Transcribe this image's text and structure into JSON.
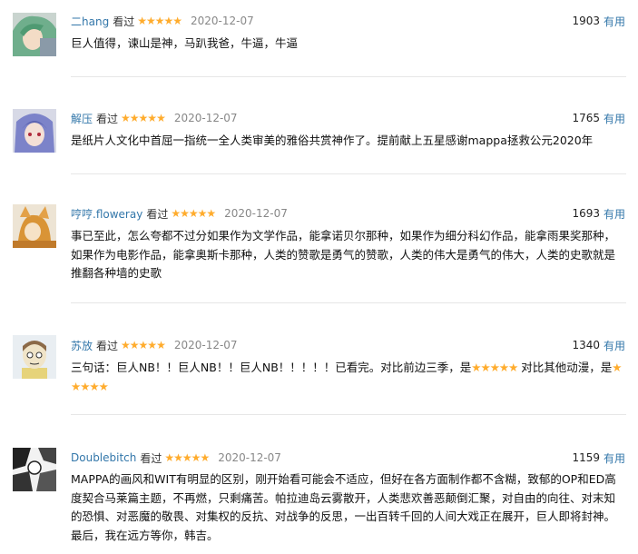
{
  "watched_label": "看过",
  "useful_label": "有用",
  "star_glyph": "★★★★★",
  "colors": {
    "link": "#3377aa",
    "star": "#ffac2d",
    "date": "#888888"
  },
  "reviews": [
    {
      "user": "二hang",
      "rating": 5,
      "date": "2020-12-07",
      "votes": "1903",
      "avatar_icon": "anime-avatar-green-hair",
      "text": "巨人值得，谏山是神，马趴我爸，牛逼，牛逼"
    },
    {
      "user": "解压",
      "rating": 5,
      "date": "2020-12-07",
      "votes": "1765",
      "avatar_icon": "anime-avatar-blue-hair",
      "text": "是纸片人文化中首屈一指统一全人类审美的雅俗共赏神作了。提前献上五星感谢mappa拯救公元2020年"
    },
    {
      "user": "哼哼.floweray",
      "rating": 5,
      "date": "2020-12-07",
      "votes": "1693",
      "avatar_icon": "anime-avatar-fox",
      "text": "事已至此，怎么夸都不过分如果作为文学作品，能拿诺贝尔那种，如果作为细分科幻作品，能拿雨果奖那种，如果作为电影作品，能拿奥斯卡那种，人类的赞歌是勇气的赞歌，人类的伟大是勇气的伟大，人类的史歌就是推翻各种墙的史歌"
    },
    {
      "user": "苏放",
      "rating": 5,
      "date": "2020-12-07",
      "votes": "1340",
      "avatar_icon": "cartoon-avatar-face",
      "text_part1": "三句话：巨人NB！！巨人NB！！巨人NB！！！！！已看完。对比前边三季，是",
      "text_part2": " 对比其他动漫，是"
    },
    {
      "user": "Doublebitch",
      "rating": 5,
      "date": "2020-12-07",
      "votes": "1159",
      "avatar_icon": "manga-avatar",
      "text": "MAPPA的画风和WIT有明显的区别，刚开始看可能会不适应，但好在各方面制作都不含糊，致郁的OP和ED高度契合马莱篇主题，不再燃，只剩痛苦。帕拉迪岛云雾散开，人类悲欢善恶颠倒汇聚，对自由的向往、对末知的恐惧、对恶魔的敬畏、对集权的反抗、对战争的反思，一出百转千回的人间大戏正在展开，巨人即将封神。最后，我在远方等你，韩吉。"
    }
  ]
}
